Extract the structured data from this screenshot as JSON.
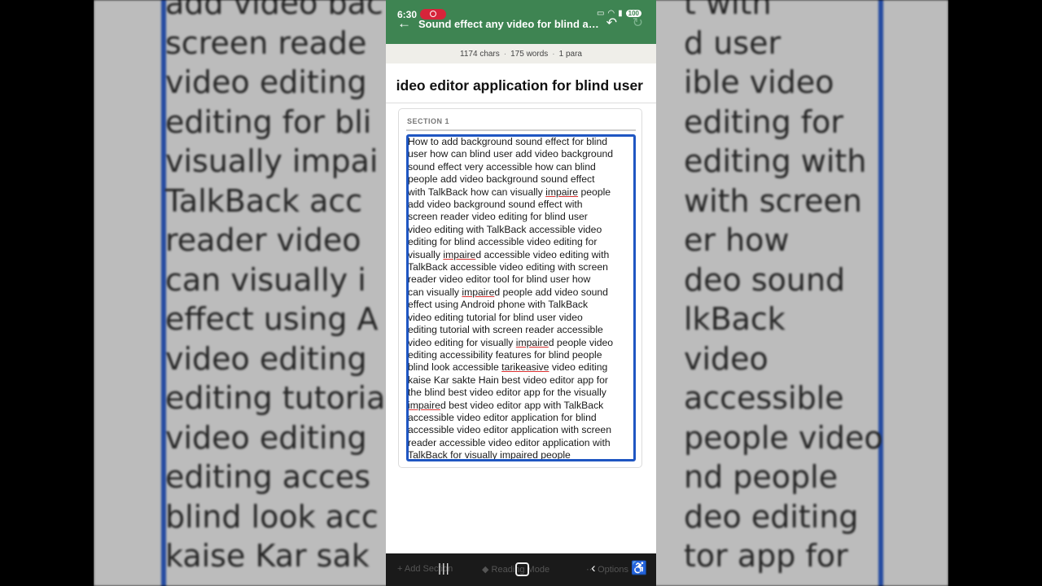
{
  "background": {
    "mirror_lines": [
      "add video bac",
      "screen reade",
      "video editing",
      "editing for bli",
      "visually impai",
      "TalkBack acc",
      "reader video",
      "can visually i",
      "effect using A",
      "video editing",
      "editing tutoria",
      "video editing",
      "editing acces",
      "blind look acc",
      "kaise Kar sak"
    ],
    "mirror_lines_right": [
      "t with",
      "d user",
      "ible video",
      "editing for",
      "editing with",
      "with screen",
      "er how",
      "deo sound",
      "lkBack",
      "video",
      "accessible",
      "people video",
      "nd people",
      "deo editing",
      "tor app for"
    ]
  },
  "status_bar": {
    "time": "6:30",
    "battery": "100"
  },
  "app_bar": {
    "title": "Sound effect any video for blind acc..."
  },
  "stats": {
    "chars": "1174 chars",
    "words": "175 words",
    "paras": "1 para"
  },
  "document": {
    "heading": "ideo editor application for blind user",
    "section_label": "SECTION 1",
    "body_lines": [
      "How to add background sound effect for blind",
      "user how can blind user add video background",
      "sound effect very accessible how can blind",
      "people add video background sound effect",
      "with TalkBack how can visually impaire people",
      "add video background sound effect with",
      "screen reader video editing for blind user",
      "video editing with TalkBack accessible video",
      "editing for blind accessible video editing for",
      "visually impaired accessible video editing with",
      "TalkBack accessible video editing with screen",
      "reader video editor tool for blind user how",
      "can visually impaired people add video sound",
      "effect using Android phone with TalkBack",
      "video editing tutorial for blind user video",
      "editing tutorial with screen reader accessible",
      "video editing for visually impaired people video",
      "editing accessibility features for blind people",
      "blind look accessible tarikeasive video editing",
      "kaise Kar sakte Hain best video editor app for",
      "the blind best video editor app for the visually",
      "impaired best video editor app with TalkBack",
      "accessible video editor application for blind",
      "accessible video editor application with screen",
      "reader accessible video editor application with",
      "TalkBack for visually impaired people"
    ],
    "misspelled": [
      "impaire",
      "tarikeasive"
    ]
  },
  "bottom_toolbar": {
    "add_section": "Add Section",
    "reading_mode": "Reading Mode",
    "options": "Options"
  },
  "colors": {
    "app_bar": "#3e8452",
    "focus_border": "#1f56c2",
    "spell_underline": "#dd3333"
  }
}
